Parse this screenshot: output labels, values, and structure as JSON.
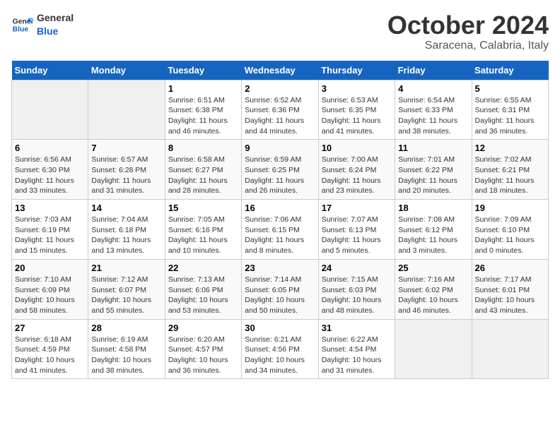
{
  "header": {
    "logo_general": "General",
    "logo_blue": "Blue",
    "month": "October 2024",
    "location": "Saracena, Calabria, Italy"
  },
  "days_of_week": [
    "Sunday",
    "Monday",
    "Tuesday",
    "Wednesday",
    "Thursday",
    "Friday",
    "Saturday"
  ],
  "weeks": [
    [
      {
        "day": "",
        "info": ""
      },
      {
        "day": "",
        "info": ""
      },
      {
        "day": "1",
        "info": "Sunrise: 6:51 AM\nSunset: 6:38 PM\nDaylight: 11 hours and 46 minutes."
      },
      {
        "day": "2",
        "info": "Sunrise: 6:52 AM\nSunset: 6:36 PM\nDaylight: 11 hours and 44 minutes."
      },
      {
        "day": "3",
        "info": "Sunrise: 6:53 AM\nSunset: 6:35 PM\nDaylight: 11 hours and 41 minutes."
      },
      {
        "day": "4",
        "info": "Sunrise: 6:54 AM\nSunset: 6:33 PM\nDaylight: 11 hours and 38 minutes."
      },
      {
        "day": "5",
        "info": "Sunrise: 6:55 AM\nSunset: 6:31 PM\nDaylight: 11 hours and 36 minutes."
      }
    ],
    [
      {
        "day": "6",
        "info": "Sunrise: 6:56 AM\nSunset: 6:30 PM\nDaylight: 11 hours and 33 minutes."
      },
      {
        "day": "7",
        "info": "Sunrise: 6:57 AM\nSunset: 6:28 PM\nDaylight: 11 hours and 31 minutes."
      },
      {
        "day": "8",
        "info": "Sunrise: 6:58 AM\nSunset: 6:27 PM\nDaylight: 11 hours and 28 minutes."
      },
      {
        "day": "9",
        "info": "Sunrise: 6:59 AM\nSunset: 6:25 PM\nDaylight: 11 hours and 26 minutes."
      },
      {
        "day": "10",
        "info": "Sunrise: 7:00 AM\nSunset: 6:24 PM\nDaylight: 11 hours and 23 minutes."
      },
      {
        "day": "11",
        "info": "Sunrise: 7:01 AM\nSunset: 6:22 PM\nDaylight: 11 hours and 20 minutes."
      },
      {
        "day": "12",
        "info": "Sunrise: 7:02 AM\nSunset: 6:21 PM\nDaylight: 11 hours and 18 minutes."
      }
    ],
    [
      {
        "day": "13",
        "info": "Sunrise: 7:03 AM\nSunset: 6:19 PM\nDaylight: 11 hours and 15 minutes."
      },
      {
        "day": "14",
        "info": "Sunrise: 7:04 AM\nSunset: 6:18 PM\nDaylight: 11 hours and 13 minutes."
      },
      {
        "day": "15",
        "info": "Sunrise: 7:05 AM\nSunset: 6:16 PM\nDaylight: 11 hours and 10 minutes."
      },
      {
        "day": "16",
        "info": "Sunrise: 7:06 AM\nSunset: 6:15 PM\nDaylight: 11 hours and 8 minutes."
      },
      {
        "day": "17",
        "info": "Sunrise: 7:07 AM\nSunset: 6:13 PM\nDaylight: 11 hours and 5 minutes."
      },
      {
        "day": "18",
        "info": "Sunrise: 7:08 AM\nSunset: 6:12 PM\nDaylight: 11 hours and 3 minutes."
      },
      {
        "day": "19",
        "info": "Sunrise: 7:09 AM\nSunset: 6:10 PM\nDaylight: 11 hours and 0 minutes."
      }
    ],
    [
      {
        "day": "20",
        "info": "Sunrise: 7:10 AM\nSunset: 6:09 PM\nDaylight: 10 hours and 58 minutes."
      },
      {
        "day": "21",
        "info": "Sunrise: 7:12 AM\nSunset: 6:07 PM\nDaylight: 10 hours and 55 minutes."
      },
      {
        "day": "22",
        "info": "Sunrise: 7:13 AM\nSunset: 6:06 PM\nDaylight: 10 hours and 53 minutes."
      },
      {
        "day": "23",
        "info": "Sunrise: 7:14 AM\nSunset: 6:05 PM\nDaylight: 10 hours and 50 minutes."
      },
      {
        "day": "24",
        "info": "Sunrise: 7:15 AM\nSunset: 6:03 PM\nDaylight: 10 hours and 48 minutes."
      },
      {
        "day": "25",
        "info": "Sunrise: 7:16 AM\nSunset: 6:02 PM\nDaylight: 10 hours and 46 minutes."
      },
      {
        "day": "26",
        "info": "Sunrise: 7:17 AM\nSunset: 6:01 PM\nDaylight: 10 hours and 43 minutes."
      }
    ],
    [
      {
        "day": "27",
        "info": "Sunrise: 6:18 AM\nSunset: 4:59 PM\nDaylight: 10 hours and 41 minutes."
      },
      {
        "day": "28",
        "info": "Sunrise: 6:19 AM\nSunset: 4:58 PM\nDaylight: 10 hours and 38 minutes."
      },
      {
        "day": "29",
        "info": "Sunrise: 6:20 AM\nSunset: 4:57 PM\nDaylight: 10 hours and 36 minutes."
      },
      {
        "day": "30",
        "info": "Sunrise: 6:21 AM\nSunset: 4:56 PM\nDaylight: 10 hours and 34 minutes."
      },
      {
        "day": "31",
        "info": "Sunrise: 6:22 AM\nSunset: 4:54 PM\nDaylight: 10 hours and 31 minutes."
      },
      {
        "day": "",
        "info": ""
      },
      {
        "day": "",
        "info": ""
      }
    ]
  ]
}
